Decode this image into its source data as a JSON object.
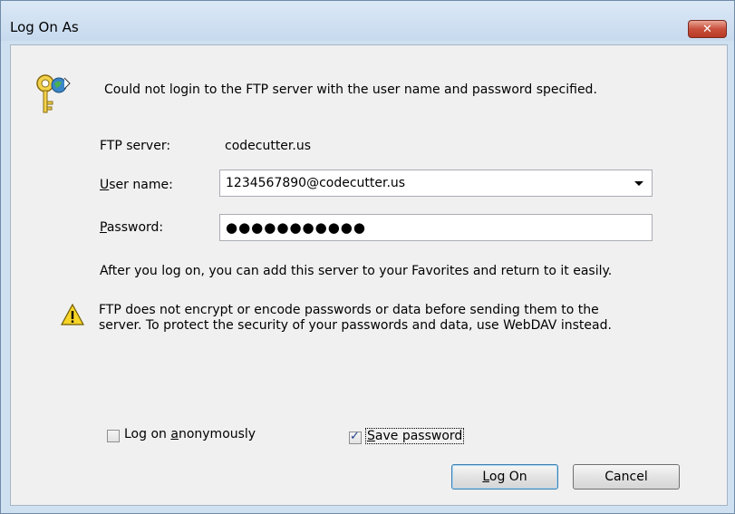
{
  "window": {
    "title": "Log On As",
    "close_glyph": "✕"
  },
  "message": {
    "text": "Could not login to the FTP server with the user name and password specified."
  },
  "form": {
    "ftp_server_label": "FTP server:",
    "ftp_server_value": "codecutter.us",
    "username_label_u": "U",
    "username_label_rest": "ser name:",
    "username_value": "1234567890@codecutter.us",
    "password_label_u": "P",
    "password_label_rest": "assword:",
    "password_mask": "●●●●●●●●●●●"
  },
  "info": {
    "favorites_text": "After you log on, you can add this server to your Favorites and return to it easily."
  },
  "warning": {
    "line1": "FTP does not encrypt or encode passwords or data before sending them to the",
    "line2": "server.  To protect the security of your passwords and data, use WebDAV instead."
  },
  "options": {
    "anonymous_pre": "Log on ",
    "anonymous_u": "a",
    "anonymous_post": "nonymously",
    "anonymous_checked": false,
    "save_u": "S",
    "save_post": "ave password",
    "save_checked": true
  },
  "buttons": {
    "logon_u": "L",
    "logon_post": "og On",
    "cancel": "Cancel"
  },
  "icons": {
    "keys": "keys-globe-icon",
    "warning": "warning-icon",
    "close": "close-icon",
    "dropdown": "chevron-down-icon"
  },
  "colors": {
    "close_button": "#c9503c",
    "default_button_border": "#3c7fb1"
  }
}
